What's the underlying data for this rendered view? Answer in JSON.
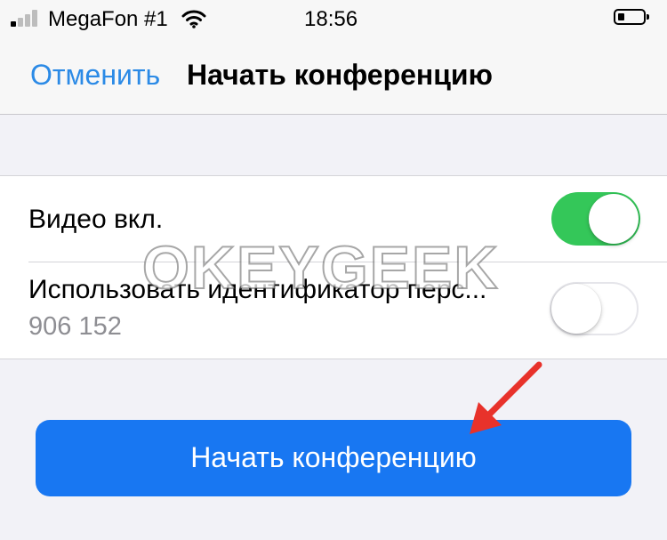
{
  "status_bar": {
    "carrier": "MegaFon #1",
    "time": "18:56",
    "signal_icon": "signal-bars-icon",
    "wifi_icon": "wifi-icon",
    "battery_icon": "battery-icon"
  },
  "nav": {
    "cancel_label": "Отменить",
    "title": "Начать конференцию"
  },
  "settings": {
    "video": {
      "label": "Видео вкл.",
      "enabled": true
    },
    "personal_id": {
      "label": "Использовать идентификатор перс...",
      "value": "906 152",
      "enabled": false
    }
  },
  "watermark": "OKEYGEEK",
  "start_button": {
    "label": "Начать конференцию"
  },
  "colors": {
    "accent_blue": "#2b8ae6",
    "button_blue": "#1877f2",
    "toggle_on": "#34c759",
    "annotation_arrow": "#e8322b"
  }
}
